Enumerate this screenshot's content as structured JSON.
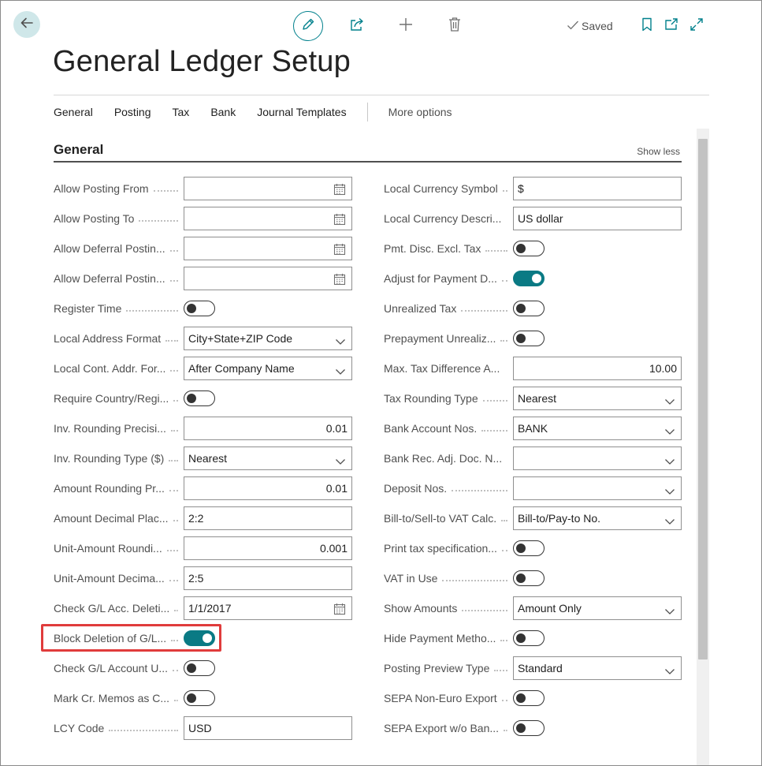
{
  "header": {
    "title": "General Ledger Setup",
    "saved_label": "Saved"
  },
  "tabs": [
    {
      "label": "General"
    },
    {
      "label": "Posting"
    },
    {
      "label": "Tax"
    },
    {
      "label": "Bank"
    },
    {
      "label": "Journal Templates"
    }
  ],
  "more_options": "More options",
  "section": {
    "title": "General",
    "show_less": "Show less"
  },
  "left_fields": [
    {
      "label": "Allow Posting From",
      "type": "date",
      "value": ""
    },
    {
      "label": "Allow Posting To",
      "type": "date",
      "value": ""
    },
    {
      "label": "Allow Deferral Postin...",
      "type": "date",
      "value": ""
    },
    {
      "label": "Allow Deferral Postin...",
      "type": "date",
      "value": ""
    },
    {
      "label": "Register Time",
      "type": "toggle",
      "on": false
    },
    {
      "label": "Local Address Format",
      "type": "select",
      "value": "City+State+ZIP Code"
    },
    {
      "label": "Local Cont. Addr. For...",
      "type": "select",
      "value": "After Company Name"
    },
    {
      "label": "Require Country/Regi...",
      "type": "toggle",
      "on": false
    },
    {
      "label": "Inv. Rounding Precisi...",
      "type": "number",
      "value": "0.01"
    },
    {
      "label": "Inv. Rounding Type ($)",
      "type": "select",
      "value": "Nearest"
    },
    {
      "label": "Amount Rounding Pr...",
      "type": "number",
      "value": "0.01"
    },
    {
      "label": "Amount Decimal Plac...",
      "type": "text",
      "value": "2:2"
    },
    {
      "label": "Unit-Amount Roundi...",
      "type": "number",
      "value": "0.001"
    },
    {
      "label": "Unit-Amount Decima...",
      "type": "text",
      "value": "2:5"
    },
    {
      "label": "Check G/L Acc. Deleti...",
      "type": "date",
      "value": "1/1/2017"
    },
    {
      "label": "Block Deletion of G/L...",
      "type": "toggle",
      "on": true
    },
    {
      "label": "Check G/L Account U...",
      "type": "toggle",
      "on": false
    },
    {
      "label": "Mark Cr. Memos as C...",
      "type": "toggle",
      "on": false
    },
    {
      "label": "LCY Code",
      "type": "text",
      "value": "USD"
    }
  ],
  "right_fields": [
    {
      "label": "Local Currency Symbol",
      "type": "text",
      "value": "$"
    },
    {
      "label": "Local Currency Descri...",
      "type": "text",
      "value": "US dollar"
    },
    {
      "label": "Pmt. Disc. Excl. Tax",
      "type": "toggle",
      "on": false
    },
    {
      "label": "Adjust for Payment D...",
      "type": "toggle",
      "on": true
    },
    {
      "label": "Unrealized Tax",
      "type": "toggle",
      "on": false
    },
    {
      "label": "Prepayment Unrealiz...",
      "type": "toggle",
      "on": false
    },
    {
      "label": "Max. Tax Difference A...",
      "type": "number",
      "value": "10.00"
    },
    {
      "label": "Tax Rounding Type",
      "type": "select",
      "value": "Nearest"
    },
    {
      "label": "Bank Account Nos.",
      "type": "select",
      "value": "BANK"
    },
    {
      "label": "Bank Rec. Adj. Doc. N...",
      "type": "select",
      "value": ""
    },
    {
      "label": "Deposit Nos.",
      "type": "select",
      "value": ""
    },
    {
      "label": "Bill-to/Sell-to VAT Calc.",
      "type": "select",
      "value": "Bill-to/Pay-to No."
    },
    {
      "label": "Print tax specification...",
      "type": "toggle",
      "on": false
    },
    {
      "label": "VAT in Use",
      "type": "toggle",
      "on": false
    },
    {
      "label": "Show Amounts",
      "type": "select",
      "value": "Amount Only"
    },
    {
      "label": "Hide Payment Metho...",
      "type": "toggle",
      "on": false
    },
    {
      "label": "Posting Preview Type",
      "type": "select",
      "value": "Standard"
    },
    {
      "label": "SEPA Non-Euro Export",
      "type": "toggle",
      "on": false
    },
    {
      "label": "SEPA Export w/o Ban...",
      "type": "toggle",
      "on": false
    }
  ],
  "icons": {
    "back": "arrow-left-icon",
    "edit": "pencil-icon",
    "share": "share-icon",
    "add": "plus-icon",
    "delete": "trash-icon",
    "saved": "check-icon",
    "bookmark": "bookmark-icon",
    "popout": "open-in-new-window-icon",
    "expand": "expand-icon",
    "calendar": "calendar-icon",
    "dropdown": "chevron-down-icon"
  },
  "colors": {
    "accent": "#00808c",
    "toggle_on": "#0a7a84",
    "highlight": "#e03c3c",
    "back_button_bg": "#cfe7e9"
  }
}
